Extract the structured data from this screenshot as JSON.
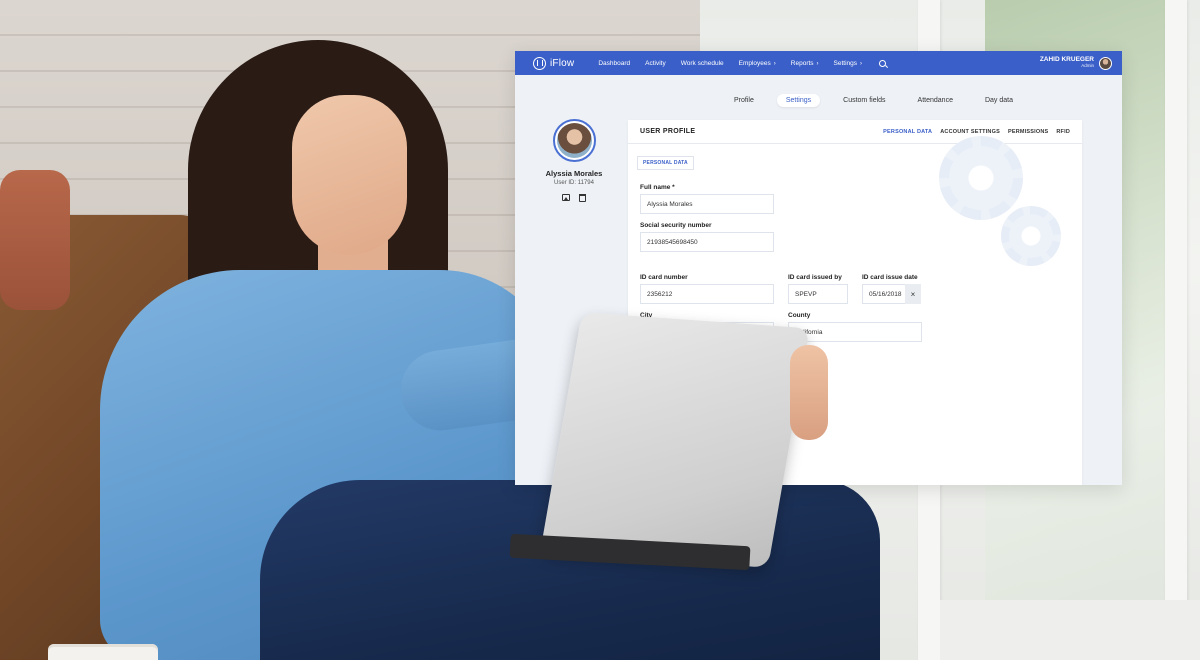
{
  "app": {
    "brand": "iFlow"
  },
  "nav": {
    "items": [
      {
        "label": "Dashboard",
        "has_caret": false
      },
      {
        "label": "Activity",
        "has_caret": false
      },
      {
        "label": "Work schedule",
        "has_caret": false
      },
      {
        "label": "Employees",
        "has_caret": true
      },
      {
        "label": "Reports",
        "has_caret": true
      },
      {
        "label": "Settings",
        "has_caret": true
      }
    ],
    "caret": "›",
    "search_icon": "search-icon"
  },
  "user": {
    "name": "ZAHID KRUEGER",
    "role": "Admin"
  },
  "page_tabs": [
    {
      "label": "Profile",
      "active": false
    },
    {
      "label": "Settings",
      "active": true
    },
    {
      "label": "Custom fields",
      "active": false
    },
    {
      "label": "Attendance",
      "active": false
    },
    {
      "label": "Day data",
      "active": false
    }
  ],
  "profile": {
    "name": "Alyssia Morales",
    "user_id": "User ID: 11794"
  },
  "card": {
    "title": "USER PROFILE",
    "tabs": [
      {
        "label": "PERSONAL DATA",
        "active": true
      },
      {
        "label": "ACCOUNT SETTINGS",
        "active": false
      },
      {
        "label": "PERMISSIONS",
        "active": false
      },
      {
        "label": "RFID",
        "active": false
      }
    ],
    "section": "PERSONAL DATA"
  },
  "form": {
    "full_name": {
      "label": "Full name *",
      "value": "Alyssia Morales"
    },
    "ssn": {
      "label": "Social security number",
      "value": "21938545698450"
    },
    "id_card_number": {
      "label": "ID card number",
      "value": "2356212"
    },
    "id_card_issued_by": {
      "label": "ID card issued by",
      "value": "SPEVP"
    },
    "id_card_issue_date": {
      "label": "ID card issue date",
      "value": "05/16/2018",
      "clear": "×"
    },
    "city": {
      "label": "City",
      "value": ""
    },
    "county": {
      "label": "County",
      "value": "California"
    }
  },
  "colors": {
    "accent": "#3a5fc8",
    "page_bg": "#eef2f7"
  }
}
